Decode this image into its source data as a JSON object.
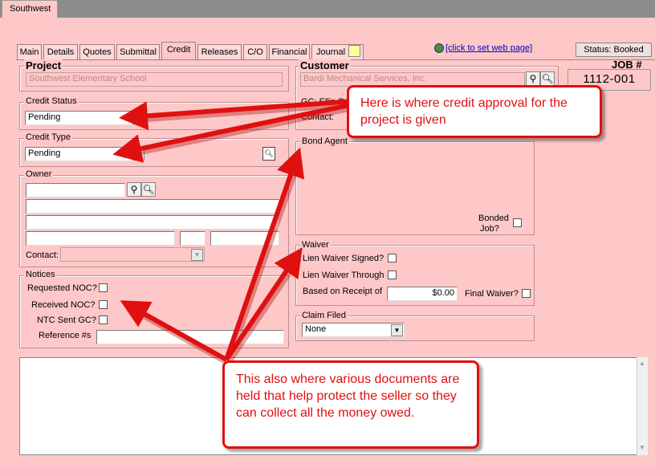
{
  "window": {
    "doc_tab": "Southwest"
  },
  "tabs": [
    {
      "label": "Main"
    },
    {
      "label": "Details"
    },
    {
      "label": "Quotes"
    },
    {
      "label": "Submittal"
    },
    {
      "label": "Credit"
    },
    {
      "label": "Releases"
    },
    {
      "label": "C/O"
    },
    {
      "label": "Financial"
    },
    {
      "label": "Journal"
    }
  ],
  "web_link": "[click to set web page]",
  "status": "Status: Booked",
  "job": {
    "label": "JOB #",
    "number": "1112-001"
  },
  "project": {
    "label": "Project",
    "value": "Southwest Elementary School"
  },
  "customer": {
    "label": "Customer",
    "value": "Bardi Mechanical Services, Inc.",
    "gc_label": "GC: Ellis-D",
    "contact_label": "Contact:"
  },
  "credit_status": {
    "label": "Credit Status",
    "value": "Pending"
  },
  "credit_type": {
    "label": "Credit Type",
    "value": "Pending"
  },
  "owner": {
    "label": "Owner",
    "contact_label": "Contact:"
  },
  "bond_agent": {
    "label": "Bond Agent",
    "bonded_label_1": "Bonded",
    "bonded_label_2": "Job?"
  },
  "waiver": {
    "label": "Waiver",
    "lien_signed": "Lien Waiver Signed?",
    "lien_through": "Lien Waiver Through",
    "based_on": "Based on Receipt of",
    "amount": "$0.00",
    "final": "Final Waiver?"
  },
  "notices": {
    "label": "Notices",
    "requested": "Requested NOC?",
    "received": "Received NOC?",
    "ntc": "NTC Sent GC?",
    "reference": "Reference #s"
  },
  "claim": {
    "label": "Claim Filed",
    "value": "None"
  },
  "annotations": {
    "callout1": "Here is where credit approval for the project is given",
    "callout2": "This also where various documents are held that help protect the seller so they can collect all the money owed."
  },
  "colors": {
    "background": "#ffc8c8",
    "callout": "#e01010"
  }
}
